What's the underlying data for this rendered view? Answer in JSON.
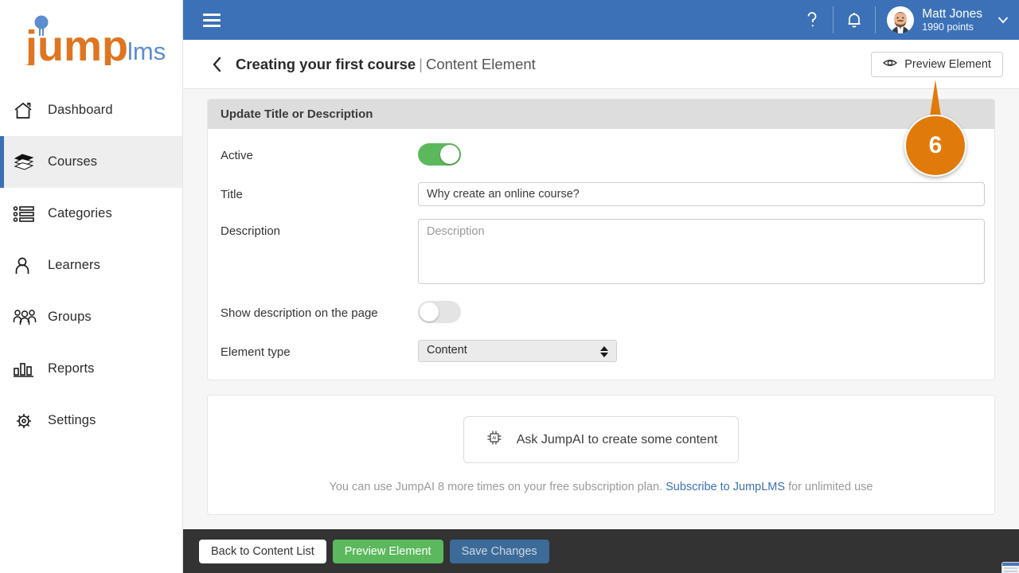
{
  "brand": {
    "logo_primary": "jump",
    "logo_secondary": "lms",
    "logo_primary_color": "#df7520",
    "logo_secondary_color": "#5b8dd0"
  },
  "sidebar": {
    "items": [
      {
        "label": "Dashboard",
        "icon": "home-icon",
        "active": false
      },
      {
        "label": "Courses",
        "icon": "books-icon",
        "active": true
      },
      {
        "label": "Categories",
        "icon": "list-icon",
        "active": false
      },
      {
        "label": "Learners",
        "icon": "user-icon",
        "active": false
      },
      {
        "label": "Groups",
        "icon": "users-icon",
        "active": false
      },
      {
        "label": "Reports",
        "icon": "bar-chart-icon",
        "active": false
      },
      {
        "label": "Settings",
        "icon": "gear-icon",
        "active": false
      }
    ]
  },
  "topbar": {
    "menu_icon": "hamburger-icon",
    "help_icon": "question-mark-icon",
    "notifications_icon": "bell-icon",
    "user_name": "Matt Jones",
    "user_points": "1990 points",
    "avatar_icon": "user-avatar",
    "caret_icon": "chevron-down-icon",
    "background_color": "#3c71b8"
  },
  "page_header": {
    "back_icon": "chevron-left-icon",
    "title_strong": "Creating your first course",
    "title_separator": "|",
    "title_light": "Content Element",
    "preview_button": "Preview Element",
    "preview_button_icon": "eye-icon"
  },
  "callout": {
    "number": "6",
    "color": "#e07b0b"
  },
  "form_card": {
    "header": "Update Title or Description",
    "rows": [
      {
        "label": "Active",
        "type": "toggle",
        "value": "on"
      },
      {
        "label": "Title",
        "type": "text",
        "value": "Why create an online course?",
        "placeholder": "Title"
      },
      {
        "label": "Description",
        "type": "textarea",
        "value": "",
        "placeholder": "Description"
      },
      {
        "label": "Show description on the page",
        "type": "toggle",
        "value": "off"
      },
      {
        "label": "Element type",
        "type": "select",
        "value": "Content",
        "options": [
          "Content"
        ]
      }
    ]
  },
  "ai_card": {
    "button_label": "Ask JumpAI to create some content",
    "button_icon": "ai-chip-icon",
    "note_before": "You can use JumpAI 8 more times on your free subscription plan. ",
    "note_link": "Subscribe to JumpLMS",
    "note_after": " for unlimited use"
  },
  "footer": {
    "back_label": "Back to Content List",
    "preview_label": "Preview Element",
    "save_label": "Save Changes"
  }
}
